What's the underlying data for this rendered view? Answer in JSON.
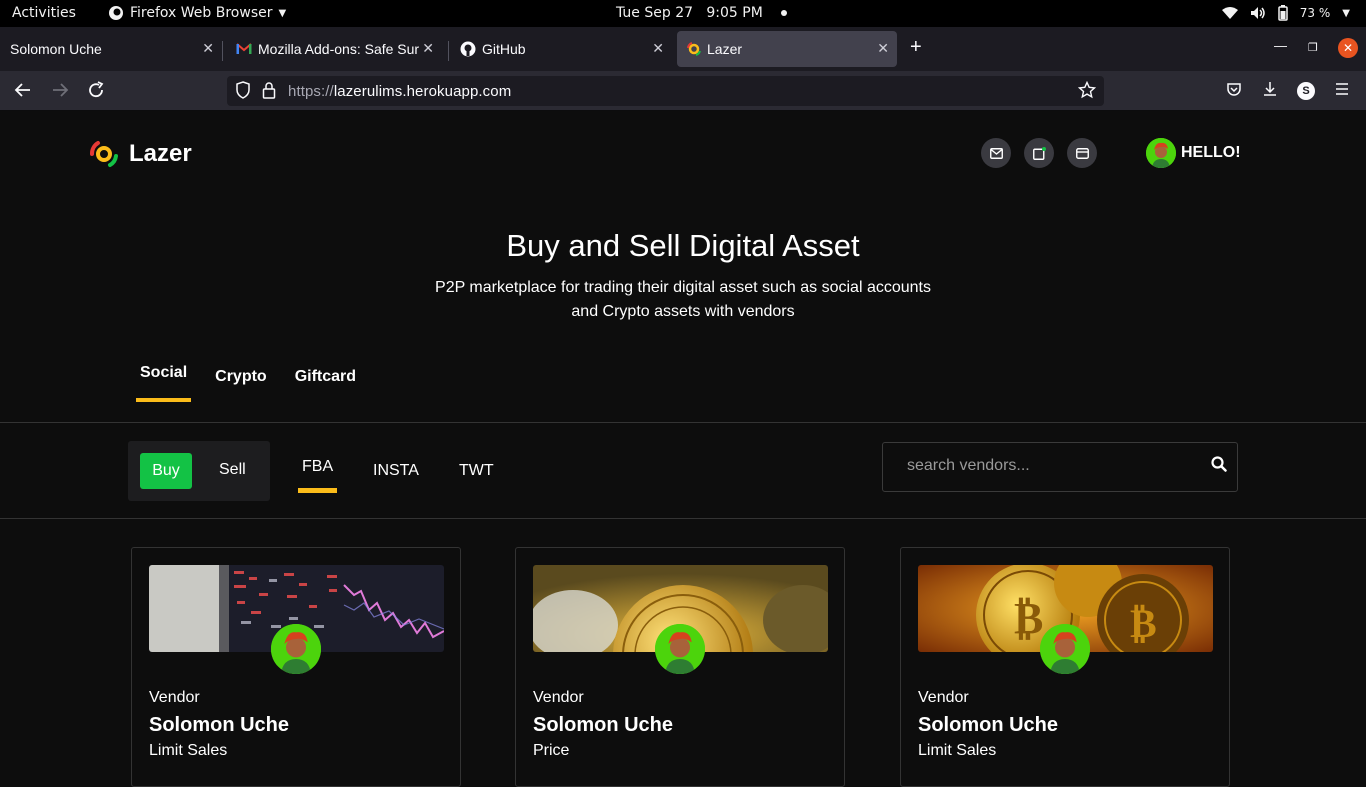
{
  "system_bar": {
    "activities": "Activities",
    "app_name": "Firefox Web Browser",
    "datetime": "Tue Sep 27   9:05 PM",
    "battery": "73 %"
  },
  "browser": {
    "tabs": [
      {
        "title": "Solomon Uche",
        "active": false
      },
      {
        "title": "Mozilla Add-ons: Safe Sur",
        "active": false
      },
      {
        "title": "GitHub",
        "active": false
      },
      {
        "title": "Lazer",
        "active": true
      }
    ],
    "url_protocol": "https://",
    "url_host": "lazerulims.herokuapp.com",
    "profile_initial": "S"
  },
  "site": {
    "brand": "Lazer",
    "greeting": "HELLO!",
    "header_icons": [
      "mail-icon",
      "add-post-icon",
      "wallet-icon"
    ],
    "hero": {
      "title": "Buy and Sell Digital Asset",
      "subtitle_line1": "P2P marketplace for trading their digital asset such as social accounts",
      "subtitle_line2": "and Crypto assets with vendors"
    },
    "categories": [
      {
        "label": "Social",
        "active": true
      },
      {
        "label": "Crypto",
        "active": false
      },
      {
        "label": "Giftcard",
        "active": false
      }
    ],
    "mode": {
      "buy": "Buy",
      "sell": "Sell",
      "selected": "Buy"
    },
    "platforms": [
      {
        "label": "FBA",
        "active": true
      },
      {
        "label": "INSTA",
        "active": false
      },
      {
        "label": "TWT",
        "active": false
      }
    ],
    "search_placeholder": "search vendors...",
    "accent_color": "#fbbc1a",
    "buy_color": "#13c245",
    "vendors": [
      {
        "role": "Vendor",
        "name": "Solomon Uche",
        "meta": "Limit Sales",
        "image": "stock-chart-screen"
      },
      {
        "role": "Vendor",
        "name": "Solomon Uche",
        "meta": "Price",
        "image": "bitcoin-coins"
      },
      {
        "role": "Vendor",
        "name": "Solomon Uche",
        "meta": "Limit Sales",
        "image": "golden-bitcoin"
      }
    ]
  }
}
